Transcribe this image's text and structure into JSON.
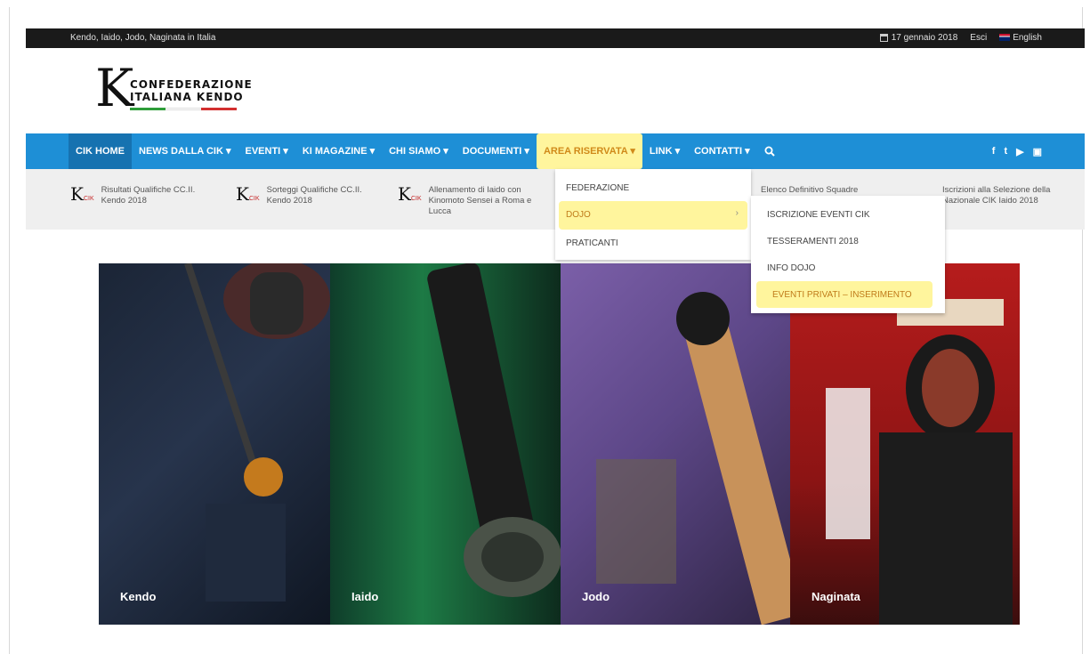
{
  "topbar": {
    "tagline": "Kendo, Iaido, Jodo, Naginata in Italia",
    "date": "17 gennaio 2018",
    "logout": "Esci",
    "language": "English"
  },
  "logo": {
    "line1": "CONFEDERAZIONE",
    "line2": "ITALIANA KENDO",
    "mark": "K"
  },
  "nav": {
    "items": [
      {
        "label": "CIK HOME"
      },
      {
        "label": "NEWS DALLA CIK ▾"
      },
      {
        "label": "EVENTI ▾"
      },
      {
        "label": "KI MAGAZINE ▾"
      },
      {
        "label": "CHI SIAMO ▾"
      },
      {
        "label": "DOCUMENTI ▾"
      },
      {
        "label": "AREA RISERVATA ▾"
      },
      {
        "label": "LINK ▾"
      },
      {
        "label": "CONTATTI ▾"
      }
    ],
    "social": [
      "f",
      "t",
      "▶",
      "▣"
    ]
  },
  "news": [
    {
      "title": "Risultati Qualifiche CC.II. Kendo 2018"
    },
    {
      "title": "Sorteggi Qualifiche CC.II. Kendo 2018"
    },
    {
      "title": "Allenamento di Iaido con Kinomoto Sensei a Roma e Lucca"
    },
    {
      "title": "Elenco Definitivo Squadre"
    },
    {
      "title": "Iscrizioni alla Selezione della Nazionale CIK Iaido 2018"
    }
  ],
  "news_badge": "CIK",
  "dropdown": {
    "items": [
      "FEDERAZIONE",
      "DOJO",
      "PRATICANTI"
    ],
    "arrow": "›"
  },
  "submenu": {
    "items": [
      "ISCRIZIONE EVENTI CIK",
      "TESSERAMENTI 2018",
      "INFO DOJO",
      "EVENTI PRIVATI – INSERIMENTO"
    ]
  },
  "panels": [
    {
      "label": "Kendo"
    },
    {
      "label": "Iaido"
    },
    {
      "label": "Jodo"
    },
    {
      "label": "Naginata"
    }
  ],
  "colors": {
    "nav": "#1e8fd6",
    "highlight": "#fff59d",
    "topbar": "#1a1a1a"
  }
}
